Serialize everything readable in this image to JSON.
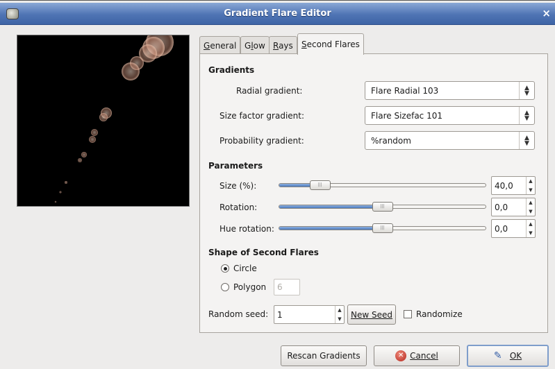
{
  "window": {
    "title": "Gradient Flare Editor",
    "close_glyph": "×"
  },
  "tabs": [
    {
      "label": "General",
      "mnemonic": "G"
    },
    {
      "label": "Glow",
      "mnemonic": "l"
    },
    {
      "label": "Rays",
      "mnemonic": "R"
    },
    {
      "label": "Second Flares",
      "mnemonic": "S",
      "active": true
    }
  ],
  "gradients": {
    "heading": "Gradients",
    "radial_label": "Radial gradient:",
    "radial_value": "Flare Radial 103",
    "sizefac_label": "Size factor gradient:",
    "sizefac_value": "Flare Sizefac 101",
    "prob_label": "Probability gradient:",
    "prob_value": "%random"
  },
  "parameters": {
    "heading": "Parameters",
    "size_label": "Size (%):",
    "size_value": "40,0",
    "size_fraction": 0.2,
    "rotation_label": "Rotation:",
    "rotation_value": "0,0",
    "rotation_fraction": 0.5,
    "hue_label": "Hue rotation:",
    "hue_value": "0,0",
    "hue_fraction": 0.5
  },
  "shape": {
    "heading": "Shape of Second Flares",
    "circle_label": "Circle",
    "polygon_label": "Polygon",
    "polygon_sides": "6",
    "selected": "circle"
  },
  "seed": {
    "label": "Random seed:",
    "value": "1",
    "new_seed_label": "New Seed",
    "randomize_label": "Randomize",
    "randomize_checked": false
  },
  "buttons": {
    "rescan_label": "Rescan Gradients",
    "cancel_label": "Cancel",
    "ok_label": "OK"
  },
  "icons": {
    "app": "gimp-icon",
    "cancel": "cancel-icon",
    "ok": "ok-icon",
    "combo_arrow": "updown-arrow-icon",
    "spin_arrows": "spin-arrows-icon"
  },
  "colors": {
    "titlebar": "#4f74b4",
    "slider_fill": "#4a78bd",
    "preview_bg": "#000000",
    "flare": "#d8a890"
  }
}
